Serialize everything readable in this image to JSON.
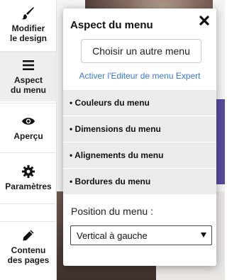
{
  "sidebar": {
    "items": [
      {
        "label": "Modifier\nle design",
        "icon": "brush-icon"
      },
      {
        "label": "Aspect\ndu menu",
        "icon": "menu-icon"
      },
      {
        "label": "Aperçu",
        "icon": "eye-icon"
      },
      {
        "label": "Paramètres",
        "icon": "gear-icon"
      },
      {
        "label": "Contenu\ndes pages",
        "icon": "pencil-icon"
      }
    ]
  },
  "panel": {
    "title": "Aspect du menu",
    "choose_button": "Choisir un autre menu",
    "expert_link": "Activer l'Editeur de menu Expert",
    "sections": [
      "• Couleurs du menu",
      "• Dimensions du menu",
      "• Alignements du menu",
      "• Bordures du menu"
    ],
    "position_label": "Position du menu :",
    "position_select": {
      "selected": "Vertical à gauche"
    }
  },
  "colors": {
    "link": "#3a7bd5",
    "section_bg": "#ebebeb"
  }
}
